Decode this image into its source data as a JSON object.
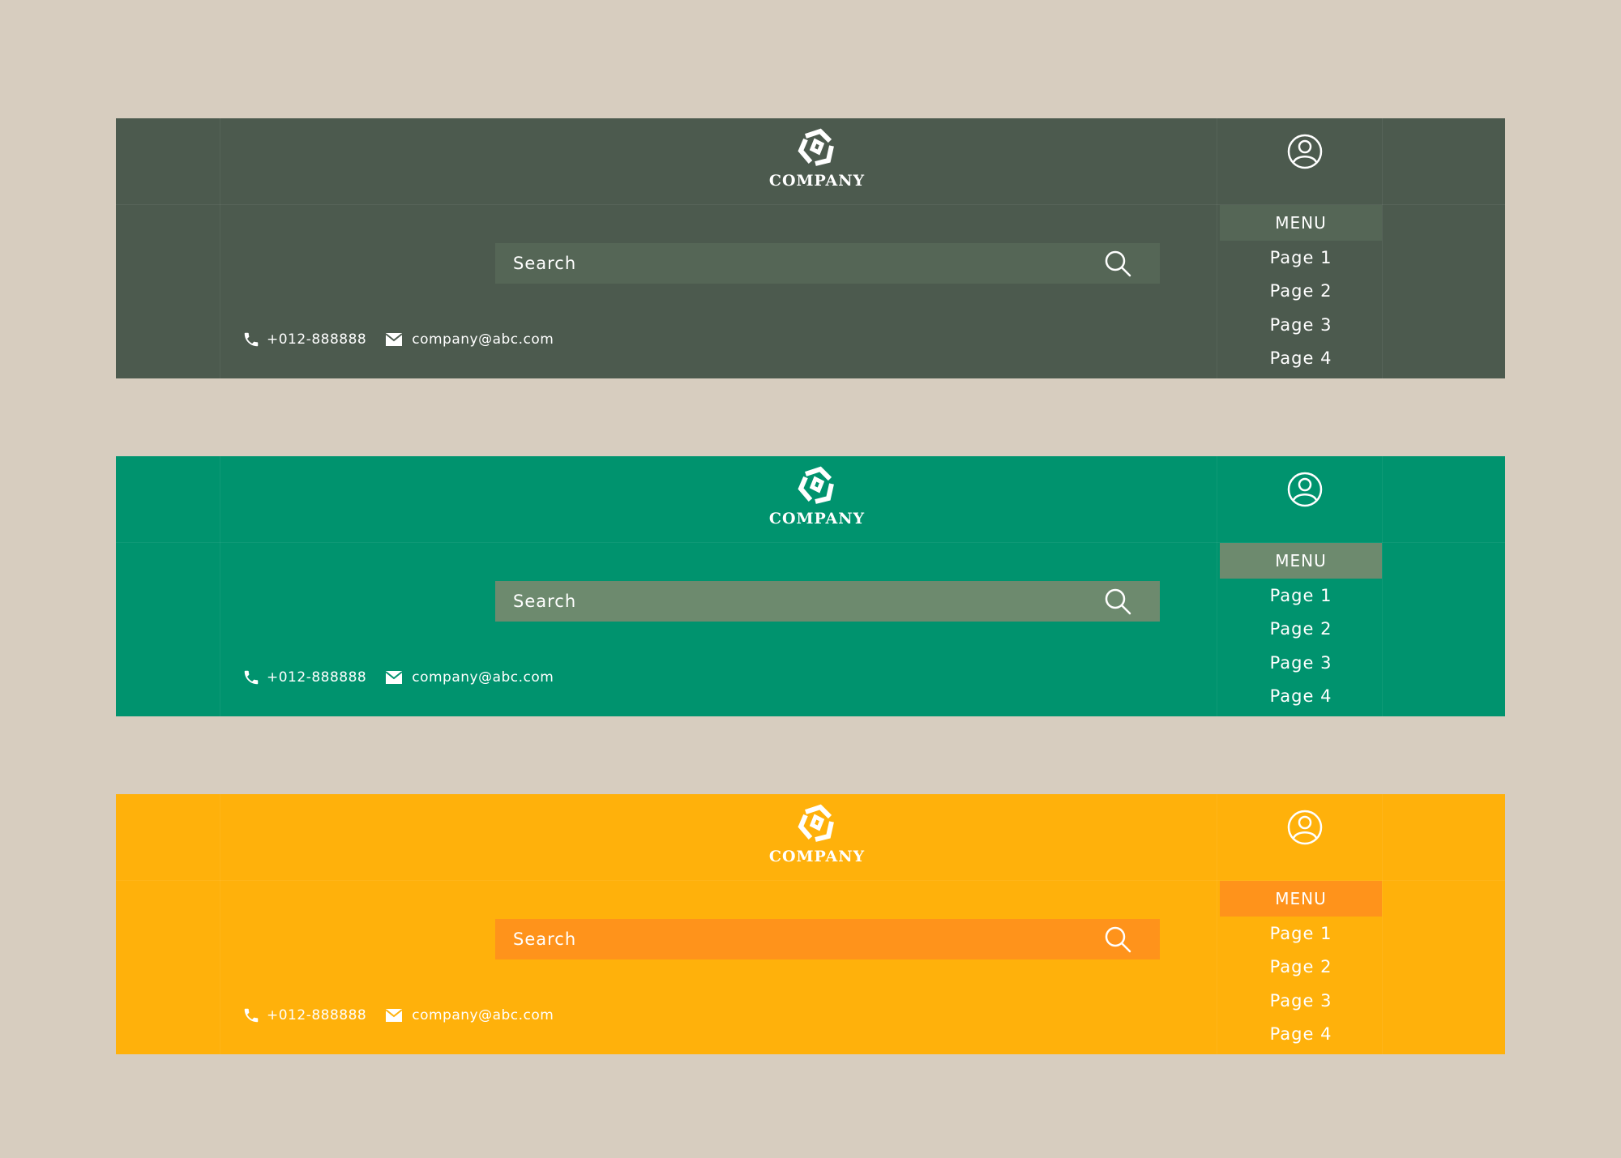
{
  "banners": [
    {
      "colors": {
        "background": "#4c5a4e",
        "search_bg": "#556656",
        "menu_header_bg": "#556656"
      },
      "brand": {
        "name": "COMPANY"
      },
      "search": {
        "placeholder": "Search"
      },
      "contact": {
        "phone": "+012-888888",
        "email": "company@abc.com"
      },
      "menu": {
        "header": "MENU",
        "items": [
          "Page 1",
          "Page 2",
          "Page 3",
          "Page 4"
        ]
      }
    },
    {
      "colors": {
        "background": "#00936e",
        "search_bg": "#6d8a6e",
        "menu_header_bg": "#6d8a6e"
      },
      "brand": {
        "name": "COMPANY"
      },
      "search": {
        "placeholder": "Search"
      },
      "contact": {
        "phone": "+012-888888",
        "email": "company@abc.com"
      },
      "menu": {
        "header": "MENU",
        "items": [
          "Page 1",
          "Page 2",
          "Page 3",
          "Page 4"
        ]
      }
    },
    {
      "colors": {
        "background": "#ffb10b",
        "search_bg": "#ff931b",
        "menu_header_bg": "#ff931b"
      },
      "brand": {
        "name": "COMPANY"
      },
      "search": {
        "placeholder": "Search"
      },
      "contact": {
        "phone": "+012-888888",
        "email": "company@abc.com"
      },
      "menu": {
        "header": "MENU",
        "items": [
          "Page 1",
          "Page 2",
          "Page 3",
          "Page 4"
        ]
      }
    }
  ],
  "icons": {
    "logo": "company-logo-icon",
    "user": "user-account-icon",
    "search": "search-icon",
    "phone": "phone-icon",
    "email": "mail-icon"
  }
}
